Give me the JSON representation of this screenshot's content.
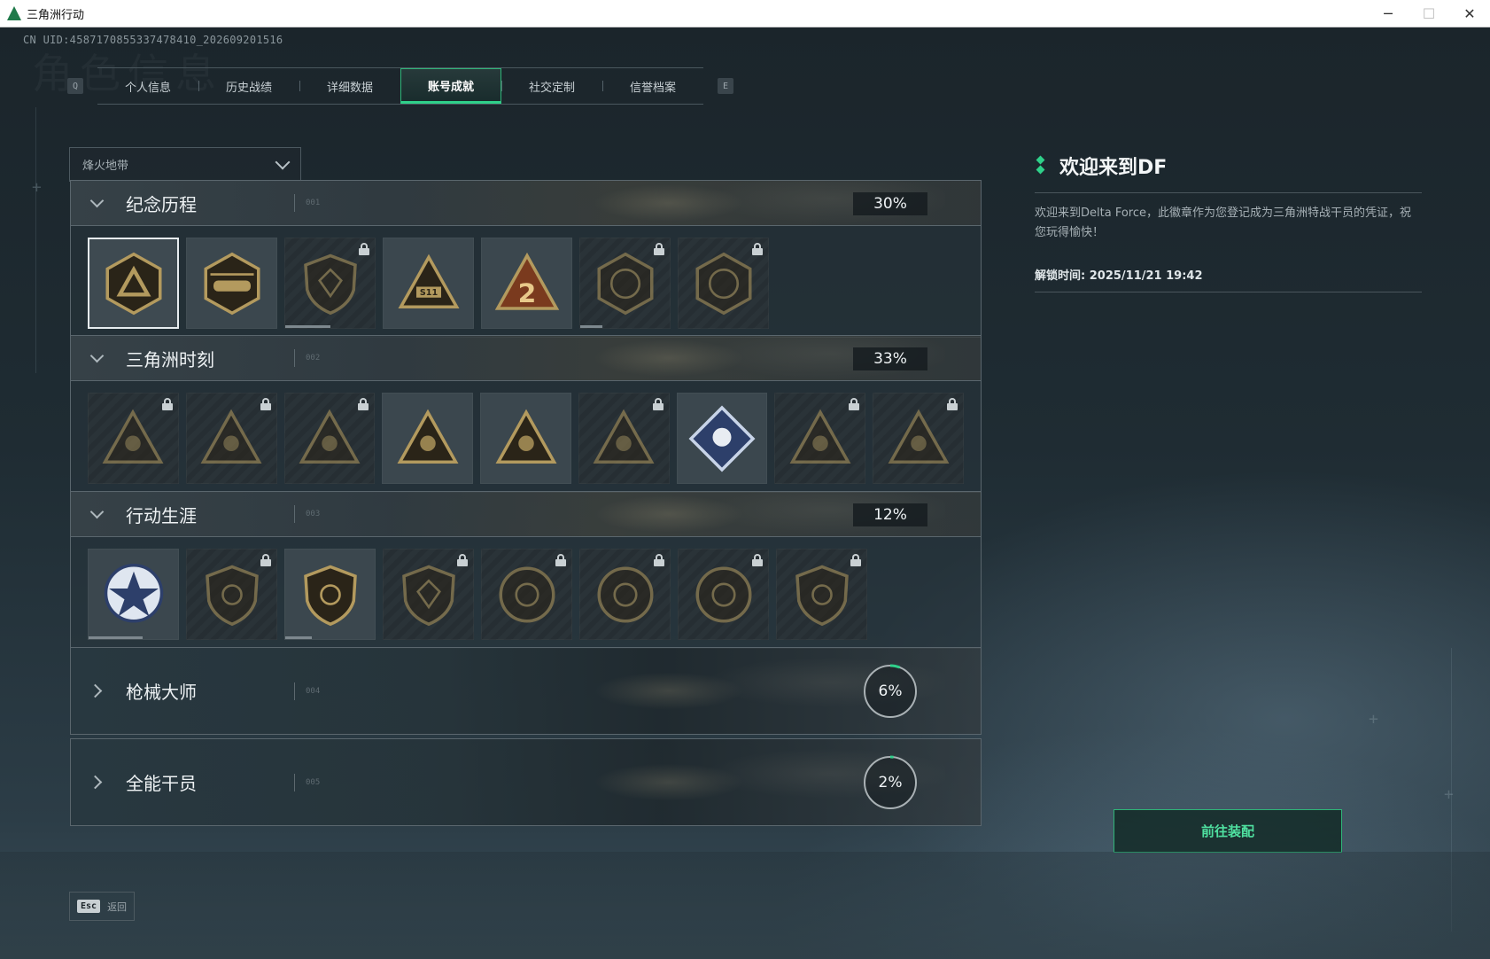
{
  "window": {
    "title": "三角洲行动",
    "minimize_glyph": "─",
    "maximize_glyph": "☐",
    "close_glyph": "✕"
  },
  "uid": "CN UID:4587170855337478410_202609201516",
  "ghost_title": "角色信息",
  "tabs": {
    "prev_key": "Q",
    "next_key": "E",
    "items": [
      {
        "label": "个人信息",
        "active": false
      },
      {
        "label": "历史战绩",
        "active": false
      },
      {
        "label": "详细数据",
        "active": false
      },
      {
        "label": "账号成就",
        "active": true
      },
      {
        "label": "社交定制",
        "active": false
      },
      {
        "label": "信誉档案",
        "active": false
      }
    ]
  },
  "mode_select": {
    "value": "烽火地带"
  },
  "categories": [
    {
      "title": "纪念历程",
      "num": "001",
      "progress": "30%",
      "progress_value": 0.3,
      "expanded": true,
      "badges": [
        {
          "icon": "delta-shield-badge-icon",
          "locked": false,
          "selected": true
        },
        {
          "icon": "helicopter-badge-icon",
          "locked": false
        },
        {
          "icon": "hex-shield-badge-icon",
          "locked": true,
          "progress": 0.5
        },
        {
          "icon": "s11-triangle-badge-icon",
          "locked": false
        },
        {
          "icon": "number-2-triangle-badge-icon",
          "locked": false
        },
        {
          "icon": "wreath-round-badge-icon",
          "locked": true,
          "progress": 0.25
        },
        {
          "icon": "season-2026-badge-icon",
          "locked": true
        }
      ]
    },
    {
      "title": "三角洲时刻",
      "num": "002",
      "progress": "33%",
      "progress_value": 0.33,
      "expanded": true,
      "badges": [
        {
          "icon": "operator-triangle-badge-icon",
          "locked": true
        },
        {
          "icon": "runner-triangle-badge-icon",
          "locked": true
        },
        {
          "icon": "heart-triangle-badge-icon",
          "locked": true
        },
        {
          "icon": "squad-triangle-badge-icon",
          "locked": false
        },
        {
          "icon": "beast-triangle-badge-icon",
          "locked": false
        },
        {
          "icon": "dolphin-triangle-badge-icon",
          "locked": true
        },
        {
          "icon": "rose-diamond-badge-icon",
          "locked": false
        },
        {
          "icon": "skull-triangle-badge-icon",
          "locked": true
        },
        {
          "icon": "mask-triangle-badge-icon",
          "locked": true
        }
      ]
    },
    {
      "title": "行动生涯",
      "num": "003",
      "progress": "12%",
      "progress_value": 0.12,
      "expanded": true,
      "badges": [
        {
          "icon": "star-medal-badge-icon",
          "locked": false,
          "progress": 0.6
        },
        {
          "icon": "diamond-shield-badge-icon",
          "locked": true
        },
        {
          "icon": "split-shield-badge-icon",
          "locked": false,
          "progress": 0.3
        },
        {
          "icon": "gem-shield-badge-icon",
          "locked": true
        },
        {
          "icon": "orb-round-badge-icon",
          "locked": true
        },
        {
          "icon": "target-round-badge-icon",
          "locked": true
        },
        {
          "icon": "eye-round-badge-icon",
          "locked": true
        },
        {
          "icon": "wolf-shield-badge-icon",
          "locked": true
        }
      ]
    },
    {
      "title": "枪械大师",
      "num": "004",
      "progress": "6%",
      "progress_value": 0.06,
      "expanded": false
    },
    {
      "title": "全能干员",
      "num": "005",
      "progress": "2%",
      "progress_value": 0.02,
      "expanded": false
    }
  ],
  "detail": {
    "title": "欢迎来到DF",
    "description": "欢迎来到Delta Force，此徽章作为您登记成为三角洲特战干员的凭证，祝您玩得愉快！",
    "unlock_label": "解锁时间:",
    "unlock_time": "2025/11/21 19:42"
  },
  "equip_button": "前往装配",
  "back": {
    "key": "Esc",
    "label": "返回"
  },
  "colors": {
    "accent": "#2fd08a",
    "badge_gold": "#b39a5e",
    "badge_dark": "#2a2418"
  }
}
